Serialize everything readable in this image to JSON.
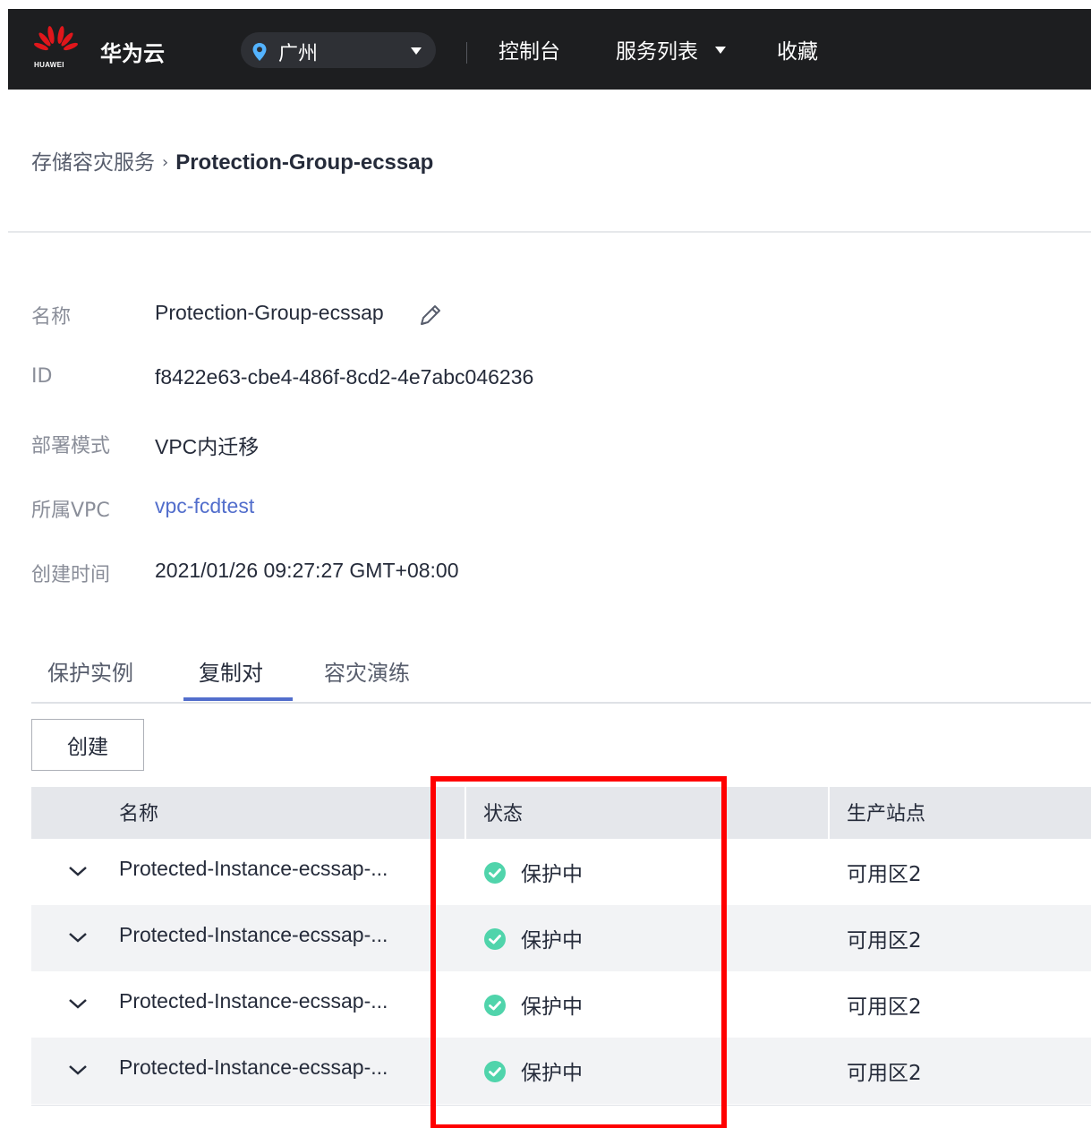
{
  "header": {
    "logo_text": "HUAWEI",
    "brand": "华为云",
    "region": "广州",
    "nav": [
      "控制台",
      "服务列表",
      "收藏"
    ]
  },
  "breadcrumb": {
    "parent": "存储容灾服务",
    "separator": "›",
    "current": "Protection-Group-ecssap"
  },
  "details": {
    "name": {
      "label": "名称",
      "value": "Protection-Group-ecssap"
    },
    "id": {
      "label": "ID",
      "value": "f8422e63-cbe4-486f-8cd2-4e7abc046236"
    },
    "mode": {
      "label": "部署模式",
      "value": "VPC内迁移"
    },
    "vpc": {
      "label": "所属VPC",
      "value": "vpc-fcdtest"
    },
    "created": {
      "label": "创建时间",
      "value": "2021/01/26 09:27:27 GMT+08:00"
    }
  },
  "tabs": {
    "items": [
      "保护实例",
      "复制对",
      "容灾演练"
    ],
    "active": "复制对"
  },
  "toolbar": {
    "create_label": "创建"
  },
  "table": {
    "columns": [
      "名称",
      "状态",
      "生产站点"
    ],
    "rows": [
      {
        "name": "Protected-Instance-ecssap-...",
        "status": "保护中",
        "site": "可用区2"
      },
      {
        "name": "Protected-Instance-ecssap-...",
        "status": "保护中",
        "site": "可用区2"
      },
      {
        "name": "Protected-Instance-ecssap-...",
        "status": "保护中",
        "site": "可用区2"
      },
      {
        "name": "Protected-Instance-ecssap-...",
        "status": "保护中",
        "site": "可用区2"
      }
    ]
  },
  "colors": {
    "accent": "#526ecc",
    "status_ok": "#50d4ab",
    "highlight": "#ff0000",
    "topbar": "#1d1e20"
  }
}
